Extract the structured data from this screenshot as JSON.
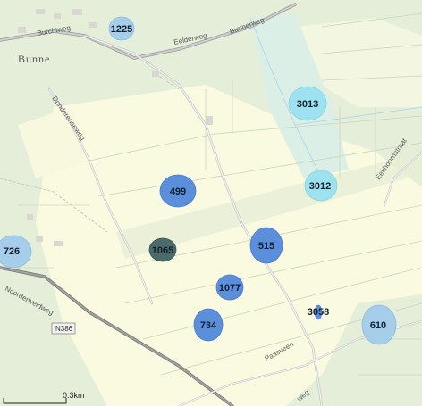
{
  "place": {
    "name": "Bunne"
  },
  "roads": {
    "burchtweg": "Burchtweg",
    "bunnerweg": "Bunnerweg",
    "eelderweg": "Eelderweg",
    "donderenseweg": "Donderenseweg",
    "noordenveldweg": "Noordenveldweg",
    "eekhoornstraat": "Eekhoornstraat",
    "paasveen": "Paasveen",
    "weg": "weg"
  },
  "route_shield": {
    "label": "N386"
  },
  "scale_bar": {
    "label": "0.3km"
  },
  "colors": {
    "blue_dark": "#5b8fdc",
    "blue_light": "#a6cdea",
    "cyan_light": "#9fe2ef",
    "slate_teal": "#4d6a6a",
    "land_pale": "#fafae0",
    "land_green": "#e4eed8"
  },
  "markers": [
    {
      "id": "m1225",
      "label": "1225",
      "color": "#a6cdea"
    },
    {
      "id": "m3013",
      "label": "3013",
      "color": "#9fe2ef"
    },
    {
      "id": "m3012",
      "label": "3012",
      "color": "#9fe2ef"
    },
    {
      "id": "m499",
      "label": "499",
      "color": "#5b8fdc"
    },
    {
      "id": "m726",
      "label": "726",
      "color": "#a6cdea"
    },
    {
      "id": "m1065",
      "label": "1065",
      "color": "#4d6a6a"
    },
    {
      "id": "m515",
      "label": "515",
      "color": "#5b8fdc"
    },
    {
      "id": "m1077",
      "label": "1077",
      "color": "#5b8fdc"
    },
    {
      "id": "m3058",
      "label": "3058",
      "color": "#5b8fdc"
    },
    {
      "id": "m734",
      "label": "734",
      "color": "#5b8fdc"
    },
    {
      "id": "m610",
      "label": "610",
      "color": "#a6cdea"
    }
  ]
}
